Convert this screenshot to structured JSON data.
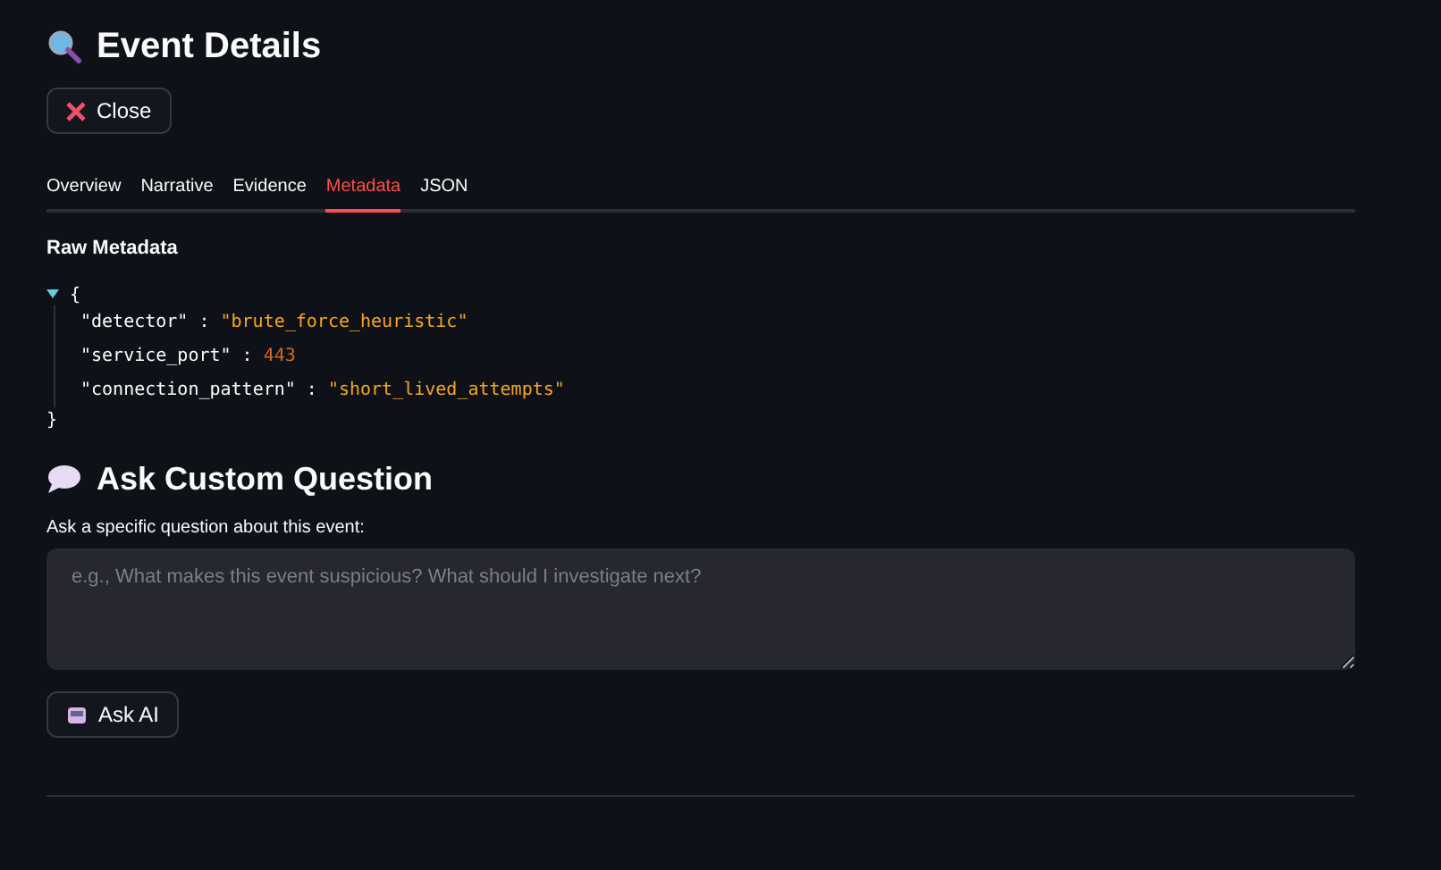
{
  "header": {
    "title": "Event Details"
  },
  "close_button": {
    "label": "Close"
  },
  "tabs": [
    {
      "label": "Overview",
      "selected": false
    },
    {
      "label": "Narrative",
      "selected": false
    },
    {
      "label": "Evidence",
      "selected": false
    },
    {
      "label": "Metadata",
      "selected": true
    },
    {
      "label": "JSON",
      "selected": false
    }
  ],
  "metadata": {
    "heading": "Raw Metadata",
    "expanded": true,
    "open_brace": "{",
    "close_brace": "}",
    "separator": ":",
    "entries": [
      {
        "key": "\"detector\"",
        "value": "\"brute_force_heuristic\"",
        "kind": "string"
      },
      {
        "key": "\"service_port\"",
        "value": "443",
        "kind": "number"
      },
      {
        "key": "\"connection_pattern\"",
        "value": "\"short_lived_attempts\"",
        "kind": "string"
      }
    ]
  },
  "question": {
    "heading": "Ask Custom Question",
    "label": "Ask a specific question about this event:",
    "placeholder": "e.g., What makes this event suspicious? What should I investigate next?",
    "button": "Ask AI"
  }
}
